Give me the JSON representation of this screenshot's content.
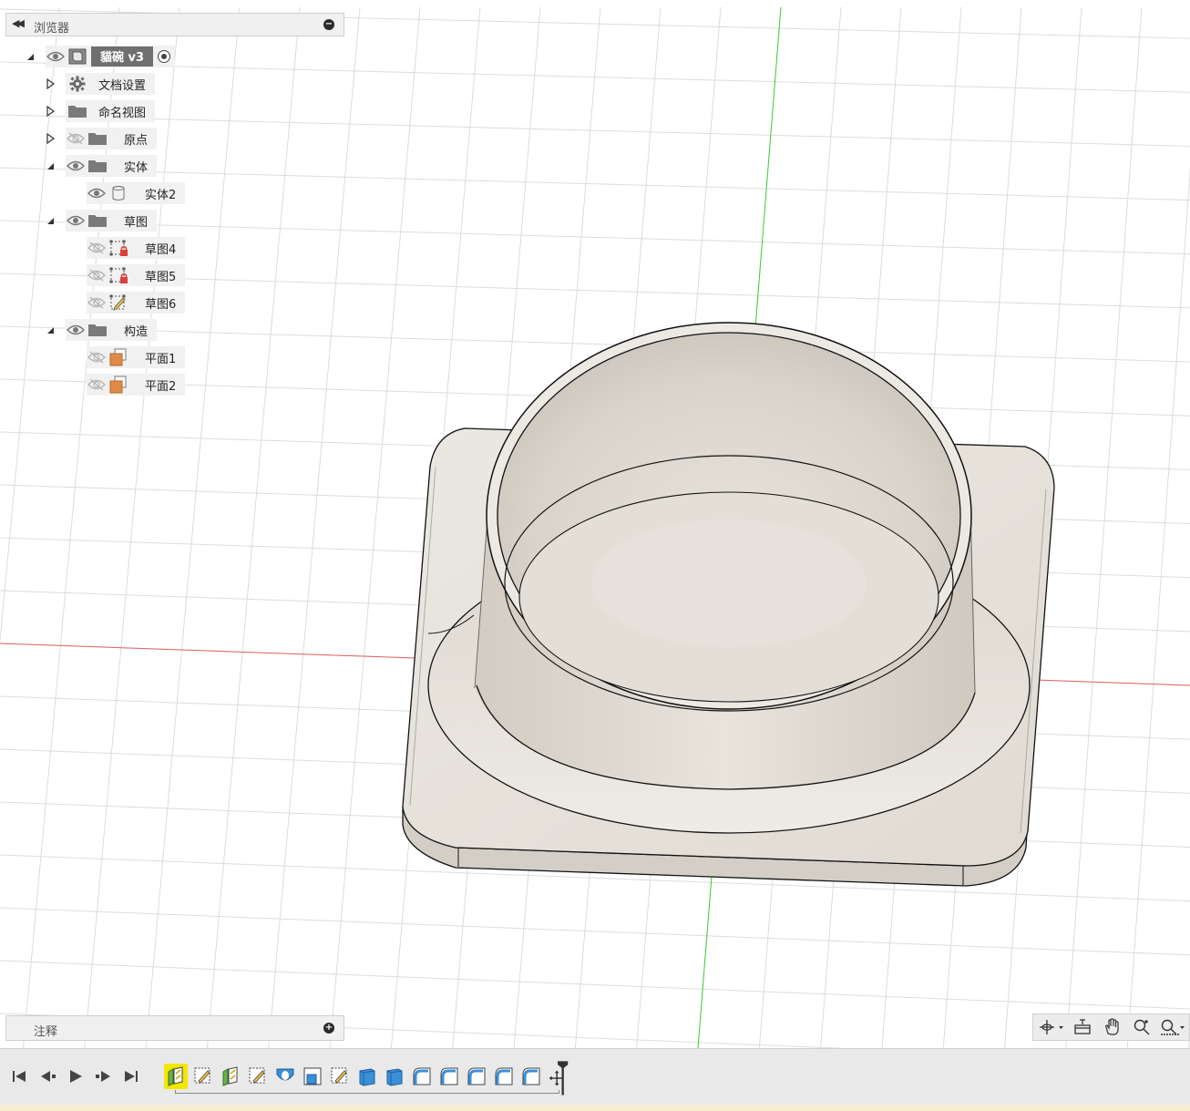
{
  "browser": {
    "title": "浏览器",
    "items": [
      {
        "label": "貓碗 v3",
        "icon": "component-box-icon",
        "visibility": "visible",
        "expander": "expanded"
      },
      {
        "label": "文档设置",
        "icon": "gear-icon",
        "visibility": "none",
        "expander": "collapsed"
      },
      {
        "label": "命名视图",
        "icon": "folder-icon",
        "visibility": "none",
        "expander": "collapsed"
      },
      {
        "label": "原点",
        "icon": "folder-icon",
        "visibility": "hidden",
        "expander": "collapsed"
      },
      {
        "label": "实体",
        "icon": "folder-icon",
        "visibility": "visible",
        "expander": "expanded"
      },
      {
        "label": "实体2",
        "icon": "body-icon",
        "visibility": "visible",
        "expander": "none"
      },
      {
        "label": "草图",
        "icon": "folder-icon",
        "visibility": "visible",
        "expander": "expanded"
      },
      {
        "label": "草图4",
        "icon": "sketch-locked-icon",
        "visibility": "hidden",
        "expander": "none"
      },
      {
        "label": "草图5",
        "icon": "sketch-locked-icon",
        "visibility": "hidden",
        "expander": "none"
      },
      {
        "label": "草图6",
        "icon": "sketch-edit-icon",
        "visibility": "hidden",
        "expander": "none"
      },
      {
        "label": "构造",
        "icon": "folder-icon",
        "visibility": "visible",
        "expander": "expanded"
      },
      {
        "label": "平面1",
        "icon": "plane-icon",
        "visibility": "hidden",
        "expander": "none"
      },
      {
        "label": "平面2",
        "icon": "plane-icon",
        "visibility": "hidden",
        "expander": "none"
      }
    ]
  },
  "annotations": {
    "title": "注释"
  },
  "nav_bar": {
    "tools": [
      {
        "name": "orbit-icon",
        "dropdown": true
      },
      {
        "name": "look-at-icon",
        "dropdown": false
      },
      {
        "name": "pan-hand-icon",
        "dropdown": false
      },
      {
        "name": "zoom-icon",
        "dropdown": false
      },
      {
        "name": "fit-zoom-icon",
        "dropdown": true
      }
    ]
  },
  "timeline": {
    "controls": [
      "skip-to-start-icon",
      "step-back-icon",
      "play-icon",
      "step-forward-icon",
      "skip-to-end-icon"
    ],
    "features": [
      {
        "type": "extrude-icon",
        "active": true
      },
      {
        "type": "sketch-icon",
        "active": false
      },
      {
        "type": "extrude-icon",
        "active": false
      },
      {
        "type": "sketch-icon",
        "active": false
      },
      {
        "type": "revolve-icon",
        "active": false
      },
      {
        "type": "shell-icon",
        "active": false
      },
      {
        "type": "sketch-icon",
        "active": false
      },
      {
        "type": "box-icon",
        "active": false
      },
      {
        "type": "box-icon",
        "active": false
      },
      {
        "type": "fillet-icon",
        "active": false
      },
      {
        "type": "fillet-icon",
        "active": false
      },
      {
        "type": "fillet-icon",
        "active": false
      },
      {
        "type": "fillet-icon",
        "active": false
      },
      {
        "type": "fillet-icon",
        "active": false
      }
    ],
    "marker": "timeline-marker-icon"
  },
  "colors": {
    "grid": "#dcdcdc",
    "axis_x": "#e46060",
    "axis_y": "#3ccd3c",
    "model_face": "#e8e4dc",
    "model_edge": "#111111",
    "panel": "#f0f0f0",
    "active_feature": "#f3e600",
    "plane": "#e08a4a"
  }
}
